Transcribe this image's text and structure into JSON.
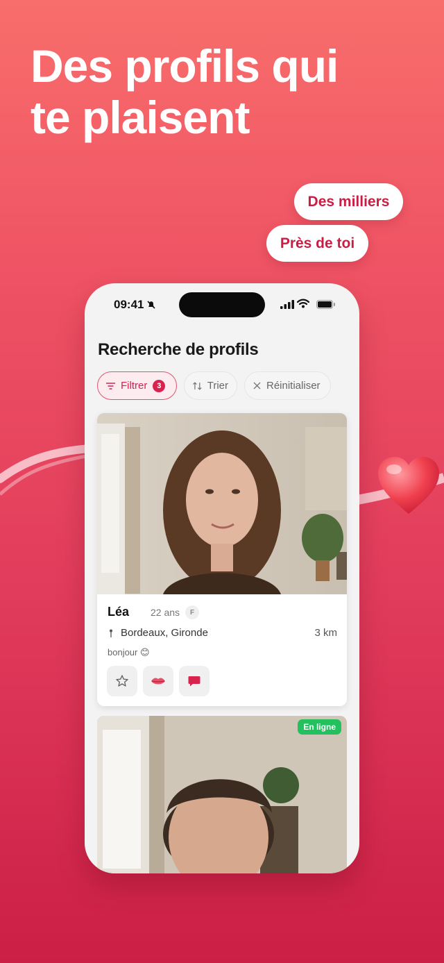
{
  "headline": {
    "line1": "Des profils qui",
    "line2": "te plaisent"
  },
  "pills": {
    "thousands": "Des milliers",
    "nearby": "Près de toi"
  },
  "phone": {
    "status_bar": {
      "time": "09:41"
    },
    "page_title": "Recherche de profils",
    "toolbar": {
      "filter_label": "Filtrer",
      "filter_count": "3",
      "sort_label": "Trier",
      "reset_label": "Réinitialiser"
    },
    "profiles": [
      {
        "name": "Léa",
        "age": "22 ans",
        "gender": "F",
        "location": "Bordeaux, Gironde",
        "distance": "3 km",
        "bio": "bonjour 😊",
        "actions": [
          "star-icon",
          "kiss-icon",
          "chat-icon"
        ]
      },
      {
        "status": "En ligne"
      }
    ]
  },
  "colors": {
    "brand": "#d61f4d",
    "online": "#22c15e",
    "background_top": "#f86e6c",
    "background_bottom": "#cc1f46"
  }
}
